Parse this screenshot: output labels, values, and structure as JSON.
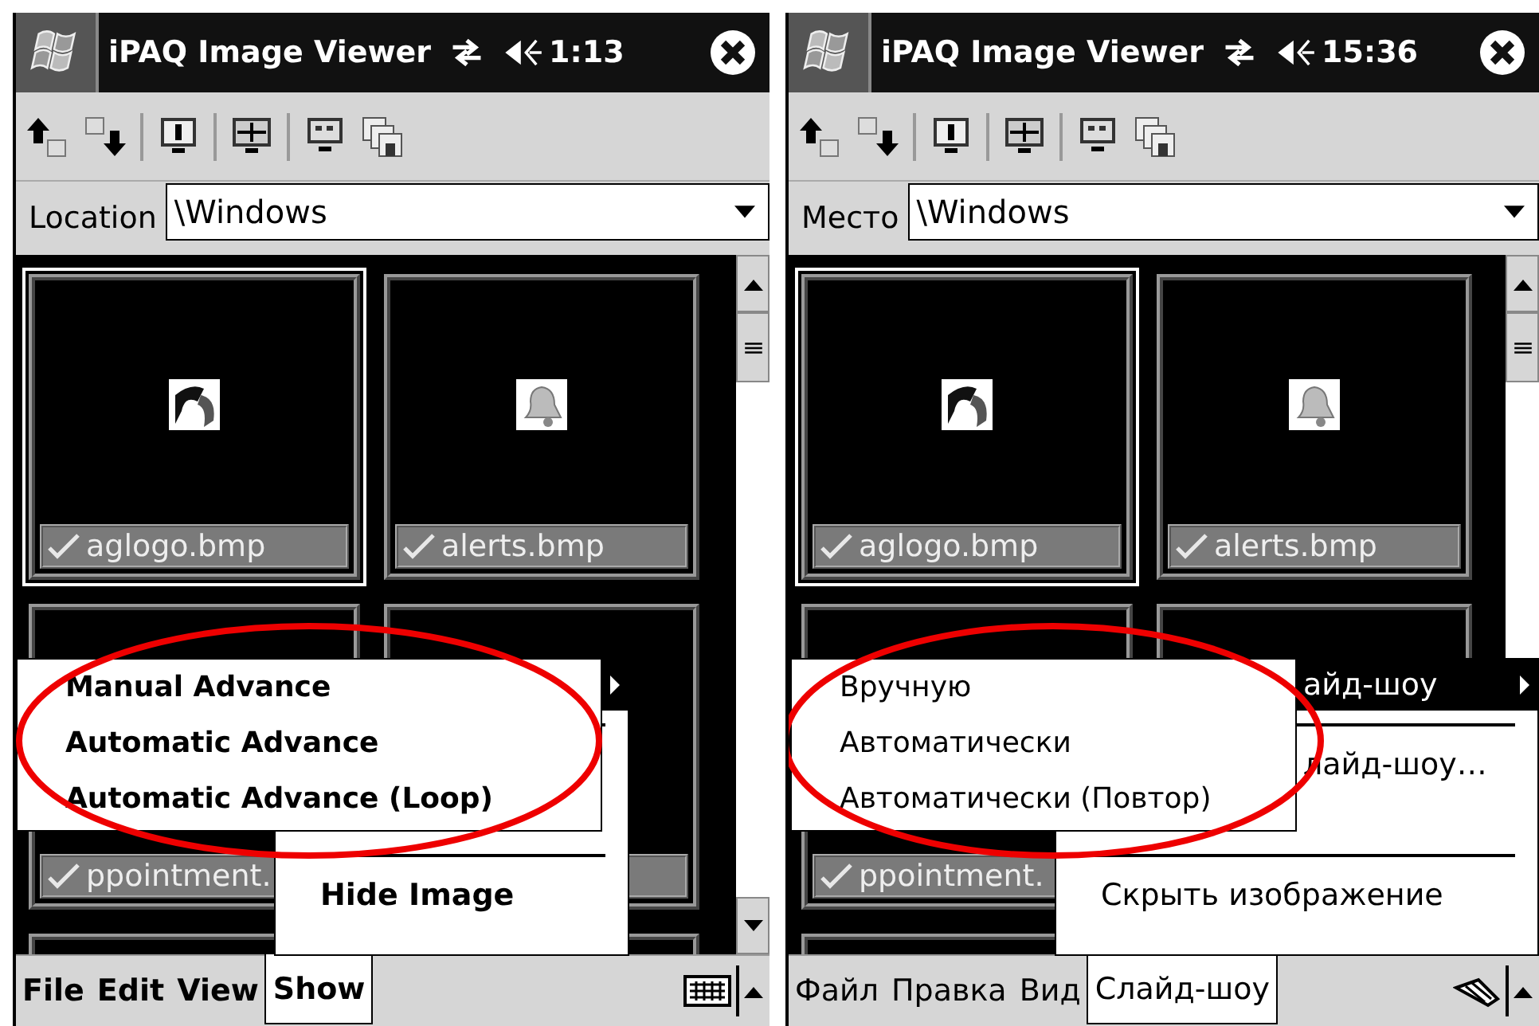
{
  "screens": [
    {
      "bold_menus": true,
      "title_bar": {
        "title": "iPAQ Image Viewer",
        "time": "1:13"
      },
      "location": {
        "label": "Location",
        "value": "\\Windows"
      },
      "thumbnails": [
        {
          "name": "aglogo.bmp",
          "checked": true,
          "selected": true
        },
        {
          "name": "alerts.bmp",
          "checked": true,
          "selected": false
        },
        {
          "name": "ppointment.",
          "checked": true,
          "selected": false
        },
        {
          "selected": false
        },
        {
          "selected": false
        },
        {
          "selected": false
        }
      ],
      "menu_bar": [
        {
          "label": "File",
          "selected": false
        },
        {
          "label": "Edit",
          "selected": false
        },
        {
          "label": "View",
          "selected": false
        },
        {
          "label": "Show",
          "selected": true
        }
      ],
      "input_method": {
        "kind": "keyboard"
      },
      "popup_menu": [
        {
          "kind": "submenu",
          "selected": true
        },
        {
          "kind": "separator"
        },
        {
          "kind": "item"
        },
        {
          "kind": "item"
        },
        {
          "kind": "separator"
        },
        {
          "kind": "item",
          "label": "Hide Image",
          "selected": false
        }
      ],
      "submenu": [
        {
          "label": "Manual Advance"
        },
        {
          "label": "Automatic Advance"
        },
        {
          "label": "Automatic Advance (Loop)"
        }
      ]
    },
    {
      "bold_menus": false,
      "title_bar": {
        "title": "iPAQ Image Viewer",
        "time": "15:36"
      },
      "location": {
        "label": "Место",
        "value": "\\Windows"
      },
      "thumbnails": [
        {
          "name": "aglogo.bmp",
          "checked": true,
          "selected": true
        },
        {
          "name": "alerts.bmp",
          "checked": true,
          "selected": false
        },
        {
          "name": "ppointment.",
          "checked": true,
          "selected": false
        },
        {
          "selected": false
        },
        {
          "selected": false
        }
      ],
      "menu_bar": [
        {
          "label": "Файл",
          "selected": false
        },
        {
          "label": "Правка",
          "selected": false
        },
        {
          "label": "Вид",
          "selected": false
        },
        {
          "label": "Слайд-шоу",
          "selected": true
        }
      ],
      "input_method": {
        "kind": "pen"
      },
      "popup_menu": [
        {
          "kind": "submenu",
          "label": "айд-шоу",
          "selected": true
        },
        {
          "kind": "separator"
        },
        {
          "kind": "item",
          "label": "лайд-шоу…",
          "selected": false
        },
        {
          "kind": "item"
        },
        {
          "kind": "separator"
        },
        {
          "kind": "item",
          "label": "Скрыть изображение",
          "selected": false
        }
      ],
      "submenu": [
        {
          "label": "Вручную"
        },
        {
          "label": "Автоматически"
        },
        {
          "label": "Автоматически (Повтор)"
        }
      ]
    }
  ]
}
